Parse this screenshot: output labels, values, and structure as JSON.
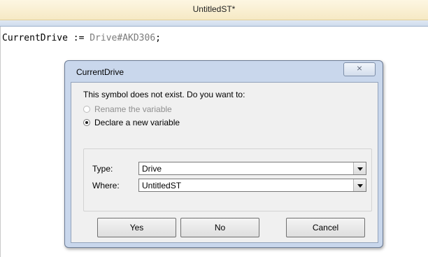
{
  "document": {
    "title": "UntitledST*",
    "code": {
      "variable": "CurrentDrive",
      "operator": ":=",
      "value": "Drive#AKD306",
      "terminator": ";"
    }
  },
  "dialog": {
    "title": "CurrentDrive",
    "close_glyph": "⨯",
    "prompt": "This symbol does not exist. Do you want to:",
    "options": [
      {
        "label": "Rename the variable",
        "selected": false,
        "enabled": false
      },
      {
        "label": "Declare a new variable",
        "selected": true,
        "enabled": true
      }
    ],
    "type_label": "Type:",
    "type_value": "Drive",
    "where_label": "Where:",
    "where_value": "UntitledST",
    "buttons": {
      "yes": "Yes",
      "no": "No",
      "cancel": "Cancel"
    }
  }
}
